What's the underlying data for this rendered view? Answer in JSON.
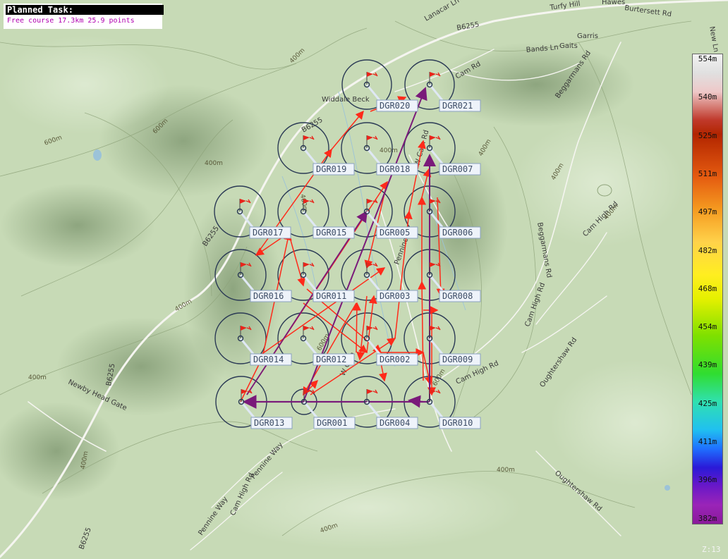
{
  "panel": {
    "title": "Planned Task:",
    "info": "Free course  17.3km 25.9 points"
  },
  "legend": {
    "labels": [
      "554m",
      "540m",
      "525m",
      "511m",
      "497m",
      "482m",
      "468m",
      "454m",
      "439m",
      "425m",
      "411m",
      "396m",
      "382m"
    ]
  },
  "zoom": "Z:13",
  "colors": {
    "leg": "#ff2a1a",
    "leg_purple": "#7a1a7a",
    "cylinder": "#2b3a55",
    "label_bg": "#eef3fa",
    "label_border": "#8aa0c0"
  },
  "waypoints": [
    {
      "id": "wp-dgr020",
      "name": "DGR020"
    },
    {
      "id": "wp-dgr021",
      "name": "DGR021"
    },
    {
      "id": "wp-dgr019",
      "name": "DGR019"
    },
    {
      "id": "wp-dgr018",
      "name": "DGR018"
    },
    {
      "id": "wp-dgr007",
      "name": "DGR007"
    },
    {
      "id": "wp-dgr017",
      "name": "DGR017"
    },
    {
      "id": "wp-dgr015",
      "name": "DGR015"
    },
    {
      "id": "wp-dgr005",
      "name": "DGR005"
    },
    {
      "id": "wp-dgr006",
      "name": "DGR006"
    },
    {
      "id": "wp-dgr016",
      "name": "DGR016"
    },
    {
      "id": "wp-dgr011",
      "name": "DGR011"
    },
    {
      "id": "wp-dgr003",
      "name": "DGR003"
    },
    {
      "id": "wp-dgr008",
      "name": "DGR008"
    },
    {
      "id": "wp-dgr014",
      "name": "DGR014"
    },
    {
      "id": "wp-dgr012",
      "name": "DGR012"
    },
    {
      "id": "wp-dgr002",
      "name": "DGR002"
    },
    {
      "id": "wp-dgr009",
      "name": "DGR009"
    },
    {
      "id": "wp-dgr013",
      "name": "DGR013"
    },
    {
      "id": "wp-dgr001",
      "name": "DGR001"
    },
    {
      "id": "wp-dgr004",
      "name": "DGR004"
    },
    {
      "id": "wp-dgr010",
      "name": "DGR010"
    }
  ],
  "map_labels": {
    "turfy_hill": "Turfy Hill",
    "hawes": "Hawes",
    "burtersett_rd": "Burtersett Rd",
    "new_ln": "New Ln",
    "lanacar_ln": "Lanacar Ln",
    "b6255_top": "B6255",
    "bands_ln": "Bands Ln",
    "gaits": "Gaits",
    "garris": "Garris",
    "cam_rd": "Cam Rd",
    "beggarmans_rd_top": "Beggarmans Rd",
    "widdale_beck": "Widdale Beck",
    "b6255_mid": "B6255",
    "b6255_left": "B6255",
    "b6255_low": "B6255",
    "b6255_bottom": "B6255",
    "w_cam_rd": "W Cam Rd",
    "beggarmans_rd": "Beggarmans Rd",
    "cam_high_rd_right": "Cam High Rd",
    "cam_high_rd_mid": "Cam High Rd",
    "cam_high_rd_low": "Cam High Rd",
    "oughtershaw_rd": "Oughtershaw Rd",
    "oughtershaw_rd_low": "Oughtershaw Rd",
    "newby_head_gate": "Newby Head Gate",
    "pennine_way_1": "Pennine Way",
    "pennine_way_2": "Pennine Way",
    "cam_high_rd_bottom": "Cam High Rd",
    "pennine": "Pennine",
    "w_cam_bottom": "W Cam"
  },
  "contours": {
    "c1": "400m",
    "c2": "600m",
    "c3": "600m",
    "c4": "400m",
    "c5": "400m",
    "c6": "400m",
    "c7": "400m",
    "c8": "400m",
    "c9": "400m",
    "c10": "400m",
    "c11": "400m",
    "c12": "400m",
    "c13": "400m",
    "c14": "400m",
    "c15": "400m",
    "c16": "600m",
    "c17": "600m"
  }
}
